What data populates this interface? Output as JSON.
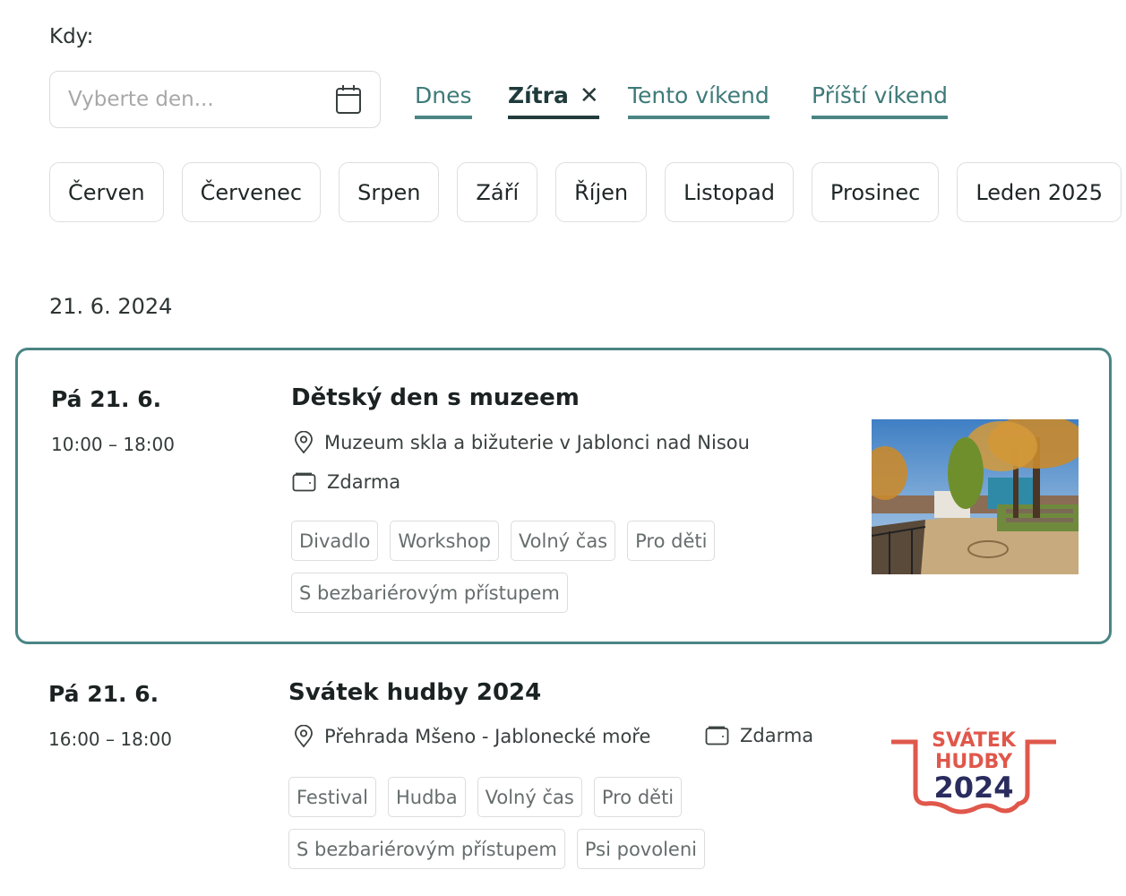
{
  "filter": {
    "when_label": "Kdy:",
    "date_placeholder": "Vyberte den...",
    "quick_filters": [
      {
        "label": "Dnes",
        "active": false
      },
      {
        "label": "Zítra",
        "active": true,
        "clear_icon": "close-icon"
      },
      {
        "label": "Tento víkend",
        "active": false
      },
      {
        "label": "Příští víkend",
        "active": false
      }
    ],
    "months": [
      "Červen",
      "Červenec",
      "Srpen",
      "Září",
      "Říjen",
      "Listopad",
      "Prosinec",
      "Leden 2025"
    ]
  },
  "colors": {
    "accent": "#4a8584",
    "accent_dark": "#223c3c",
    "logo_red": "#e0574b",
    "logo_navy": "#2a2c5e"
  },
  "day_heading": "21. 6. 2024",
  "events": [
    {
      "day": "Pá 21. 6.",
      "time": "10:00 – 18:00",
      "title": "Dětský den s muzeem",
      "location": "Muzeum skla a bižuterie v Jablonci nad Nisou",
      "price": "Zdarma",
      "tags": [
        "Divadlo",
        "Workshop",
        "Volný čas",
        "Pro děti",
        "S bezbariérovým přístupem"
      ],
      "image": "autumn-park-photo",
      "highlighted": true
    },
    {
      "day": "Pá 21. 6.",
      "time": "16:00 – 18:00",
      "title": "Svátek hudby 2024",
      "location": "Přehrada Mšeno - Jablonecké moře",
      "price": "Zdarma",
      "tags": [
        "Festival",
        "Hudba",
        "Volný čas",
        "Pro děti",
        "S bezbariérovým přístupem",
        "Psi povoleni"
      ],
      "logo": {
        "line1": "SVÁTEK",
        "line2": "HUDBY",
        "line3": "2024"
      },
      "highlighted": false
    }
  ]
}
